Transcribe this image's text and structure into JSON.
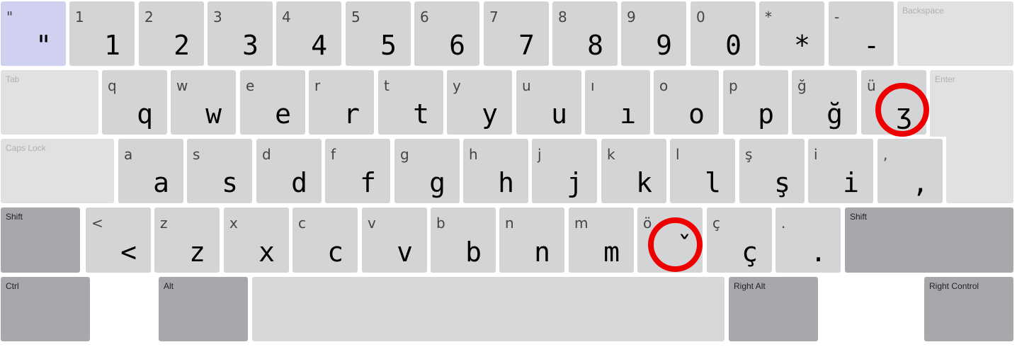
{
  "rows": {
    "number": [
      {
        "sub": "\"",
        "main": "\""
      },
      {
        "sub": "1",
        "main": "1"
      },
      {
        "sub": "2",
        "main": "2"
      },
      {
        "sub": "3",
        "main": "3"
      },
      {
        "sub": "4",
        "main": "4"
      },
      {
        "sub": "5",
        "main": "5"
      },
      {
        "sub": "6",
        "main": "6"
      },
      {
        "sub": "7",
        "main": "7"
      },
      {
        "sub": "8",
        "main": "8"
      },
      {
        "sub": "9",
        "main": "9"
      },
      {
        "sub": "0",
        "main": "0"
      },
      {
        "sub": "*",
        "main": "*"
      },
      {
        "sub": "-",
        "main": "-"
      }
    ],
    "top": [
      {
        "sub": "q",
        "main": "q"
      },
      {
        "sub": "w",
        "main": "w"
      },
      {
        "sub": "e",
        "main": "e"
      },
      {
        "sub": "r",
        "main": "r"
      },
      {
        "sub": "t",
        "main": "t"
      },
      {
        "sub": "y",
        "main": "y"
      },
      {
        "sub": "u",
        "main": "u"
      },
      {
        "sub": "ı",
        "main": "ı"
      },
      {
        "sub": "o",
        "main": "o"
      },
      {
        "sub": "p",
        "main": "p"
      },
      {
        "sub": "ğ",
        "main": "ğ"
      },
      {
        "sub": "ü",
        "main": "ʒ"
      }
    ],
    "home": [
      {
        "sub": "a",
        "main": "a"
      },
      {
        "sub": "s",
        "main": "s"
      },
      {
        "sub": "d",
        "main": "d"
      },
      {
        "sub": "f",
        "main": "f"
      },
      {
        "sub": "g",
        "main": "g"
      },
      {
        "sub": "h",
        "main": "h"
      },
      {
        "sub": "j",
        "main": "j"
      },
      {
        "sub": "k",
        "main": "k"
      },
      {
        "sub": "l",
        "main": "l"
      },
      {
        "sub": "ş",
        "main": "ş"
      },
      {
        "sub": "i",
        "main": "i"
      },
      {
        "sub": ",",
        "main": ","
      }
    ],
    "bottom": [
      {
        "sub": "<",
        "main": "<"
      },
      {
        "sub": "z",
        "main": "z"
      },
      {
        "sub": "x",
        "main": "x"
      },
      {
        "sub": "c",
        "main": "c"
      },
      {
        "sub": "v",
        "main": "v"
      },
      {
        "sub": "b",
        "main": "b"
      },
      {
        "sub": "n",
        "main": "n"
      },
      {
        "sub": "m",
        "main": "m"
      },
      {
        "sub": "ö",
        "main": "ˇ"
      },
      {
        "sub": "ç",
        "main": "ç"
      },
      {
        "sub": ".",
        "main": "."
      }
    ]
  },
  "modifiers": {
    "backspace": "Backspace",
    "tab": "Tab",
    "enter": "Enter",
    "caps_lock": "Caps Lock",
    "shift_left": "Shift",
    "shift_right": "Shift",
    "ctrl": "Ctrl",
    "alt": "Alt",
    "right_alt": "Right Alt",
    "right_control": "Right Control"
  },
  "colors": {
    "key": "#d3d4d6",
    "modifier_dark": "#a7a8ab",
    "modifier_light": "#e0e1e3",
    "highlighted_key": "#d0d0f0",
    "annotation_circle": "#ee0000"
  }
}
